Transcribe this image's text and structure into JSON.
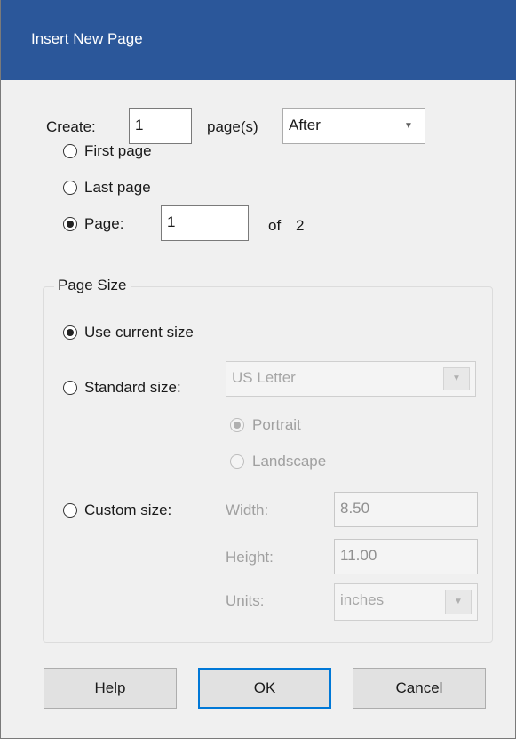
{
  "dialog": {
    "title": "Insert New Page"
  },
  "create": {
    "label": "Create:",
    "count": "1",
    "suffix": "page(s)",
    "position": "After"
  },
  "placement": {
    "first_page": "First page",
    "last_page": "Last page",
    "page_label": "Page:",
    "page_value": "1",
    "of_label": "of",
    "total_pages": "2",
    "selected": "page"
  },
  "page_size": {
    "group_title": "Page Size",
    "use_current": "Use current size",
    "standard": "Standard size:",
    "standard_value": "US Letter",
    "portrait": "Portrait",
    "landscape": "Landscape",
    "custom": "Custom size:",
    "width_label": "Width:",
    "width_value": "8.50",
    "height_label": "Height:",
    "height_value": "11.00",
    "units_label": "Units:",
    "units_value": "inches",
    "selected": "use_current"
  },
  "buttons": {
    "help": "Help",
    "ok": "OK",
    "cancel": "Cancel"
  },
  "colors": {
    "titlebar": "#2b579a",
    "dialog_bg": "#f0f0f0",
    "focus_border": "#0078d7"
  }
}
